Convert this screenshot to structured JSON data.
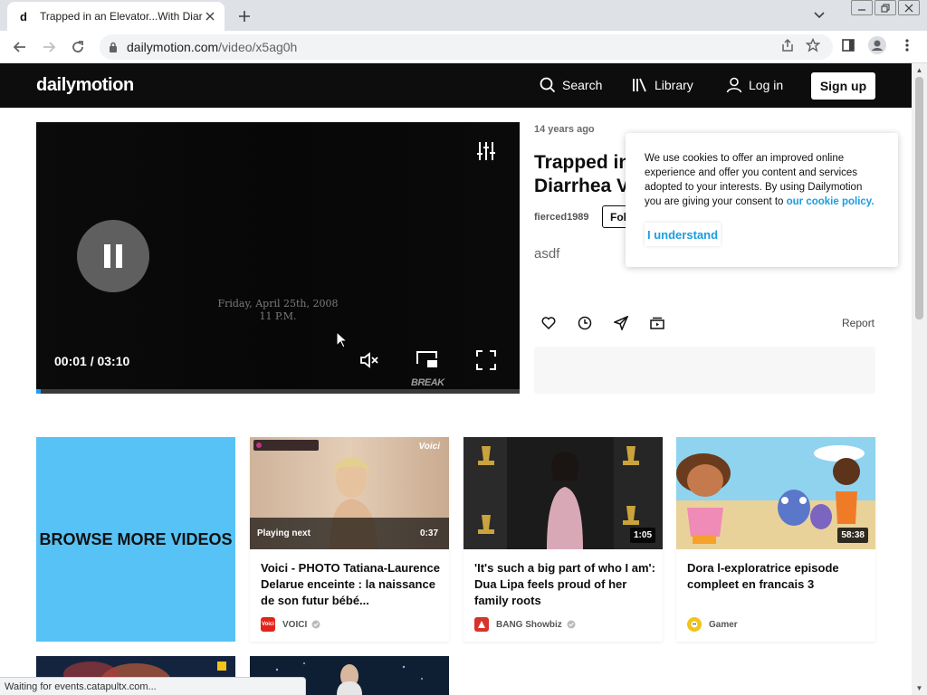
{
  "browser": {
    "tab": {
      "favicon": "d",
      "title": "Trapped in an Elevator...With Diarrhea"
    },
    "url": {
      "host": "dailymotion.com",
      "path": "/video/x5ag0h"
    },
    "status_text": "Waiting for events.catapultx.com..."
  },
  "header": {
    "logo": "dailymotion",
    "search_label": "Search",
    "library_label": "Library",
    "login_label": "Log in",
    "signup_label": "Sign up"
  },
  "player": {
    "frame_line1": "Friday, April 25th, 2008",
    "frame_line2": "11 P.M.",
    "time_current": "00:01",
    "time_total": "03:10",
    "watermark": "BREAK",
    "progress": 0.01
  },
  "video": {
    "age": "14 years ago",
    "title_line1": "Trapped in",
    "title_line2": "Diarrhea V",
    "owner": "fierced1989",
    "follow_label": "Follow",
    "description": "asdf",
    "report_label": "Report"
  },
  "cookie": {
    "text": "We use cookies to offer an improved online experience and offer you content and services adopted to your interests. By using Dailymotion you are giving your consent to ",
    "link": "our cookie policy.",
    "button": "I understand"
  },
  "browse_more": "BROWSE MORE VIDEOS",
  "cards": [
    {
      "title": "Voici - PHOTO Tatiana-Laurence Delarue enceinte : la naissance de son futur bébé...",
      "channel": "VOICI",
      "duration": "0:37",
      "playing_next": "Playing next",
      "thumb_badge": "Voici",
      "avatar_text": "Voici",
      "avatar_color": "#e2231a"
    },
    {
      "title": "'It's such a big part of who I am': Dua Lipa feels proud of her family roots",
      "channel": "BANG Showbiz",
      "duration": "1:05",
      "avatar_color": "#d6332b"
    },
    {
      "title": "Dora l-exploratrice episode compleet en francais 3",
      "channel": "Gamer",
      "duration": "58:38",
      "avatar_color": "#f2c318"
    }
  ]
}
